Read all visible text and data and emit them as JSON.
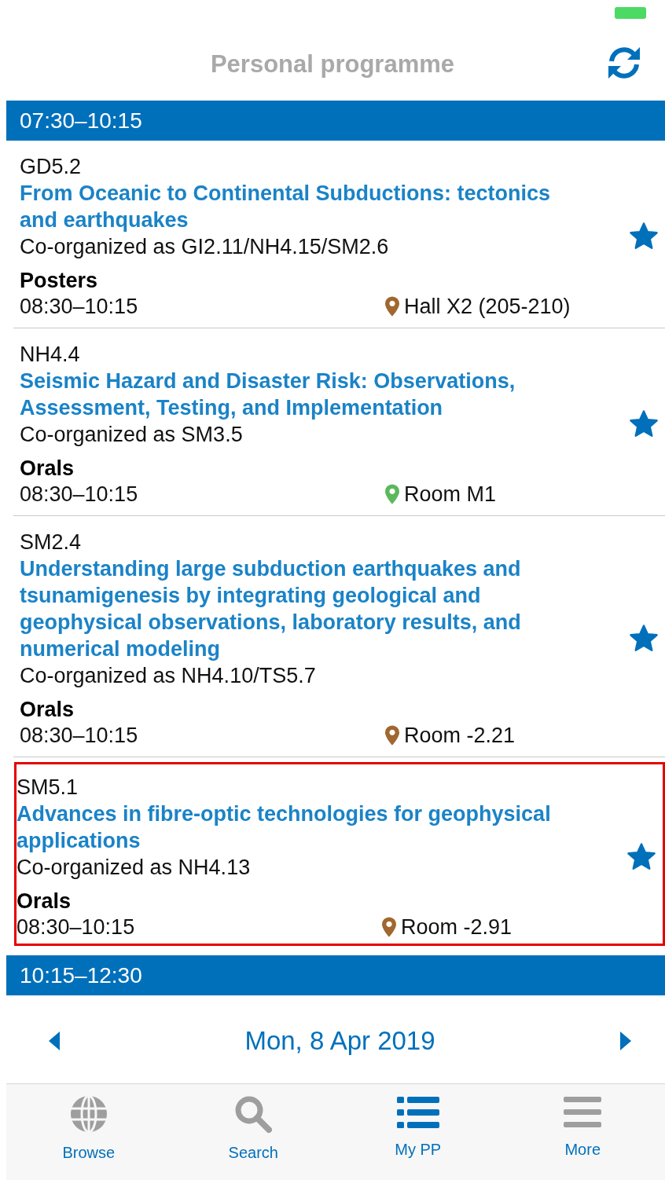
{
  "header": {
    "title": "Personal programme"
  },
  "blocks": [
    {
      "time": "07:30–10:15",
      "sessions": [
        {
          "code": "GD5.2",
          "title": "From Oceanic to Continental Subductions: tectonics and earthquakes",
          "coorganized": "Co-organized as GI2.11/NH4.15/SM2.6",
          "type": "Posters",
          "time": "08:30–10:15",
          "location": "Hall X2 (205-210)",
          "color": "#a0672f",
          "starred": true,
          "selected": false
        },
        {
          "code": "NH4.4",
          "title": "Seismic Hazard and Disaster Risk: Observations, Assessment, Testing, and Implementation",
          "coorganized": "Co-organized as SM3.5",
          "type": "Orals",
          "time": "08:30–10:15",
          "location": "Room M1",
          "color": "#5cb85c",
          "starred": true,
          "selected": false
        },
        {
          "code": "SM2.4",
          "title": "Understanding large subduction earthquakes and tsunamigenesis by integrating geological and geophysical observations, laboratory results, and numerical modeling",
          "coorganized": "Co-organized as NH4.10/TS5.7",
          "type": "Orals",
          "time": "08:30–10:15",
          "location": "Room -2.21",
          "color": "#a0672f",
          "starred": true,
          "selected": false
        },
        {
          "code": "SM5.1",
          "title": "Advances in fibre-optic technologies for geophysical applications",
          "coorganized": "Co-organized as NH4.13",
          "type": "Orals",
          "time": "08:30–10:15",
          "location": "Room -2.91",
          "color": "#a0672f",
          "starred": true,
          "selected": true
        }
      ]
    },
    {
      "time": "10:15–12:30"
    }
  ],
  "date_nav": {
    "date": "Mon, 8 Apr 2019"
  },
  "tabs": [
    {
      "label": "Browse",
      "kind": "globe",
      "selected": false
    },
    {
      "label": "Search",
      "kind": "search",
      "selected": false
    },
    {
      "label": "My PP",
      "kind": "list",
      "selected": true
    },
    {
      "label": "More",
      "kind": "menu",
      "selected": false
    }
  ]
}
